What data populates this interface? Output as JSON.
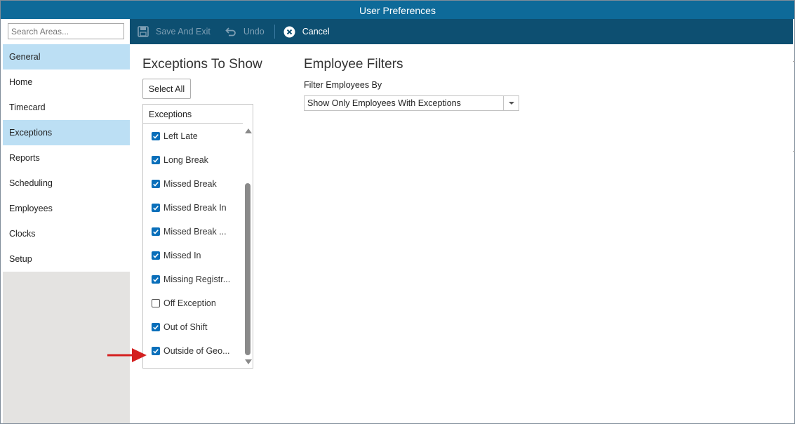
{
  "window": {
    "title": "User Preferences"
  },
  "search": {
    "placeholder": "Search Areas..."
  },
  "sidebar": {
    "items": [
      {
        "label": "General",
        "active": true
      },
      {
        "label": "Home",
        "active": false
      },
      {
        "label": "Timecard",
        "active": false
      },
      {
        "label": "Exceptions",
        "active": true
      },
      {
        "label": "Reports",
        "active": false
      },
      {
        "label": "Scheduling",
        "active": false
      },
      {
        "label": "Employees",
        "active": false
      },
      {
        "label": "Clocks",
        "active": false
      },
      {
        "label": "Setup",
        "active": false
      }
    ]
  },
  "toolbar": {
    "save_label": "Save And Exit",
    "undo_label": "Undo",
    "cancel_label": "Cancel"
  },
  "exceptions": {
    "title": "Exceptions To Show",
    "select_all_label": "Select All",
    "column_header": "Exceptions",
    "items": [
      {
        "label": "Left Late",
        "checked": true
      },
      {
        "label": "Long Break",
        "checked": true
      },
      {
        "label": "Missed Break",
        "checked": true
      },
      {
        "label": "Missed Break In",
        "checked": true
      },
      {
        "label": "Missed Break ...",
        "checked": true
      },
      {
        "label": "Missed In",
        "checked": true
      },
      {
        "label": "Missing Registr...",
        "checked": true
      },
      {
        "label": "Off Exception",
        "checked": false
      },
      {
        "label": "Out of Shift",
        "checked": true
      },
      {
        "label": "Outside of Geo...",
        "checked": true
      }
    ]
  },
  "filters": {
    "title": "Employee Filters",
    "filter_by_label": "Filter Employees By",
    "filter_by_value": "Show Only Employees With Exceptions"
  },
  "colors": {
    "titlebar": "#0e6a99",
    "toolbar": "#0d4f71",
    "nav_active": "#bcdff4",
    "checkbox": "#0a6fba",
    "annotation_arrow": "#d42020"
  }
}
